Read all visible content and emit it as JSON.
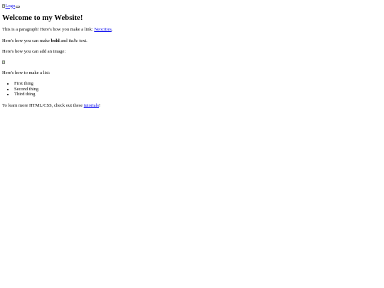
{
  "header": {
    "logo_alt": "Logo"
  },
  "main": {
    "heading": "Welcome to my Website!",
    "paragraph1": {
      "before_link": "This is a paragraph! Here's how you make a link: ",
      "link_text": "Neocities",
      "after_link": "."
    },
    "paragraph2": {
      "before_bold": "Here's how you can make ",
      "bold_text": "bold",
      "middle": " and ",
      "italic_text": "italic",
      "after_italic": " text."
    },
    "paragraph3": "Here's how you can add an image:",
    "paragraph4": "Here's how to make a list:",
    "list_items": [
      "First thing",
      "Second thing",
      "Third thing"
    ],
    "paragraph5": {
      "before_link": "To learn more HTML/CSS, check out these ",
      "link_text": "tutorials",
      "after_link": "!"
    }
  }
}
